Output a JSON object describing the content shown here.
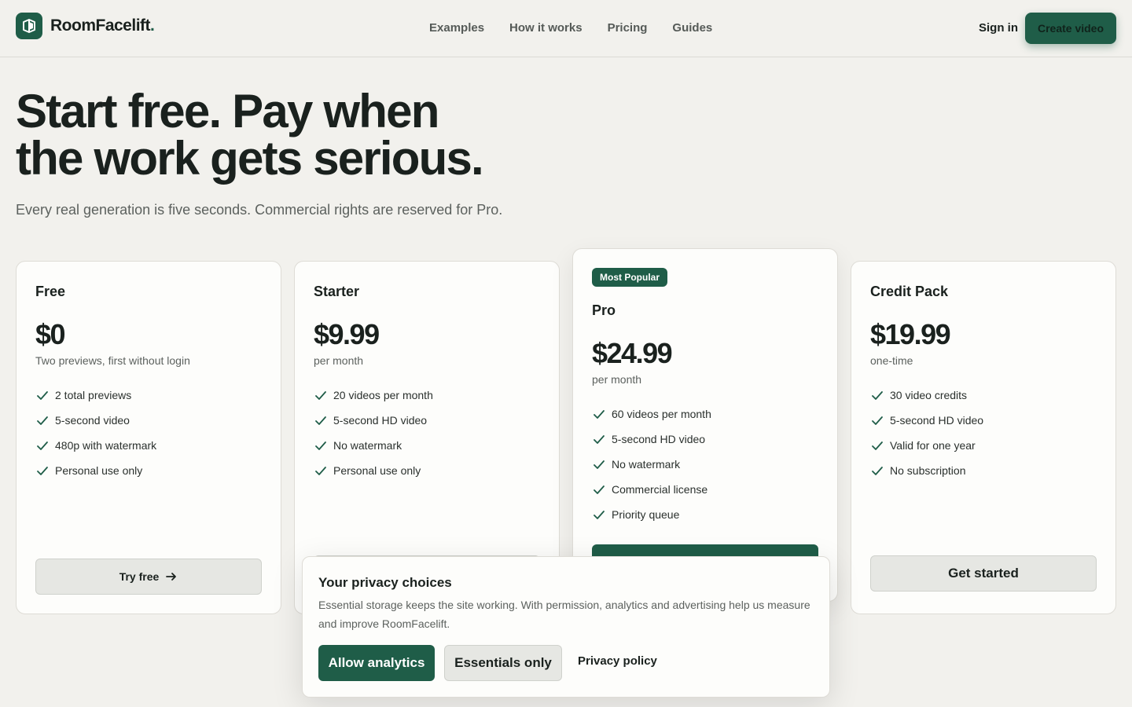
{
  "header": {
    "brand": "RoomFacelift",
    "brand_dot": ".",
    "nav": [
      "Examples",
      "How it works",
      "Pricing",
      "Guides"
    ],
    "sign_in": "Sign in",
    "cta": "Create video"
  },
  "hero": {
    "title_line1": "Start free. Pay when",
    "title_line2": "the work gets serious.",
    "subtitle": "Every real generation is five seconds. Commercial rights are reserved for Pro."
  },
  "plans": [
    {
      "name": "Free",
      "price": "$0",
      "note": "Two previews, first without login",
      "features": [
        "2 total previews",
        "5-second video",
        "480p with watermark",
        "Personal use only"
      ],
      "button": "Try free"
    },
    {
      "name": "Starter",
      "price": "$9.99",
      "note": "per month",
      "features": [
        "20 videos per month",
        "5-second HD video",
        "No watermark",
        "Personal use only"
      ]
    },
    {
      "badge": "Most Popular",
      "name": "Pro",
      "price": "$24.99",
      "note": "per month",
      "features": [
        "60 videos per month",
        "5-second HD video",
        "No watermark",
        "Commercial license",
        "Priority queue"
      ]
    },
    {
      "name": "Credit Pack",
      "price": "$19.99",
      "note": "one-time",
      "features": [
        "30 video credits",
        "5-second HD video",
        "Valid for one year",
        "No subscription"
      ],
      "button": "Get started"
    }
  ],
  "privacy": {
    "title": "Your privacy choices",
    "body": "Essential storage keeps the site working. With permission, analytics and advertising help us measure and improve RoomFacelift.",
    "allow": "Allow analytics",
    "essentials": "Essentials only",
    "policy": "Privacy policy"
  },
  "colors": {
    "accent": "#1f5d48",
    "background": "#f2f1ed",
    "card": "#fdfdfb",
    "text": "#1a211e"
  }
}
